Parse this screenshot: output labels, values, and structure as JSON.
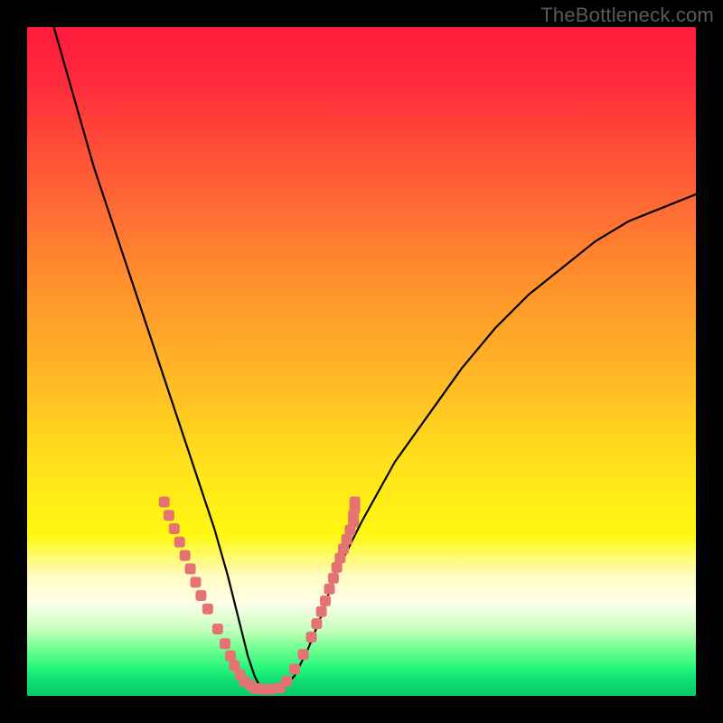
{
  "watermark": {
    "text": "TheBottleneck.com"
  },
  "chart_data": {
    "type": "line",
    "title": "",
    "xlabel": "",
    "ylabel": "",
    "xlim": [
      0,
      100
    ],
    "ylim": [
      0,
      100
    ],
    "series": [
      {
        "name": "curve",
        "x": [
          4,
          6,
          8,
          10,
          12,
          14,
          16,
          18,
          20,
          22,
          24,
          26,
          28,
          30,
          31,
          32,
          33,
          34,
          35,
          36,
          38,
          40,
          42,
          44,
          46,
          50,
          55,
          60,
          65,
          70,
          75,
          80,
          85,
          90,
          95,
          100
        ],
        "y": [
          100,
          93,
          86,
          79,
          73,
          67,
          61,
          55,
          49,
          43,
          37,
          31,
          25,
          18,
          14,
          10,
          6,
          3,
          1,
          1,
          1,
          3,
          7,
          12,
          18,
          26,
          35,
          42,
          49,
          55,
          60,
          64,
          68,
          71,
          73,
          75
        ]
      }
    ],
    "highlight": {
      "segments": [
        {
          "x": [
            20.5,
            21.2,
            22.0,
            22.8,
            23.6,
            24.4,
            25.2,
            26.0
          ],
          "y": [
            29.0,
            27.0,
            25.0,
            23.0,
            21.0,
            19.0,
            17.0,
            15.0
          ]
        },
        {
          "x": [
            27.0,
            28.5,
            29.6,
            30.4,
            31.0,
            31.8,
            32.5,
            33.5,
            34.2,
            35.2,
            36.4,
            37.8
          ],
          "y": [
            13.0,
            10.0,
            7.8,
            6.0,
            4.5,
            3.2,
            2.2,
            1.5,
            1.1,
            1.0,
            1.0,
            1.2
          ]
        },
        {
          "x": [
            38.8,
            40.0,
            41.3,
            42.5,
            43.3,
            44.0,
            44.6,
            45.2,
            45.8,
            46.3,
            46.8,
            47.3,
            47.8,
            48.3,
            48.8
          ],
          "y": [
            2.2,
            4.0,
            6.2,
            8.8,
            10.8,
            12.6,
            14.2,
            16.0,
            17.6,
            19.2,
            20.6,
            22.0,
            23.4,
            24.8,
            26.0
          ]
        },
        {
          "x": [
            48.8,
            49.0,
            49.0
          ],
          "y": [
            27.0,
            28.0,
            29.0
          ]
        }
      ]
    }
  }
}
